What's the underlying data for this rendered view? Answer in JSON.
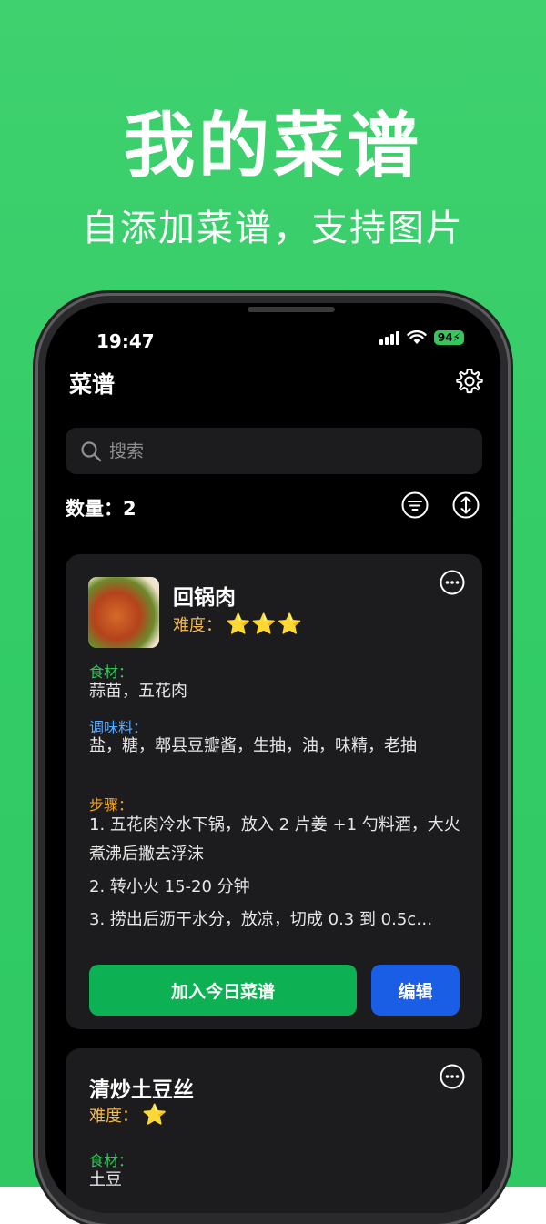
{
  "hero": {
    "title": "我的菜谱",
    "subtitle": "自添加菜谱，支持图片"
  },
  "status_bar": {
    "time": "19:47",
    "battery": "94"
  },
  "nav": {
    "title": "菜谱",
    "settings_icon": "gear-icon"
  },
  "search": {
    "placeholder": "搜索"
  },
  "list": {
    "count_label": "数量：",
    "count": "2"
  },
  "recipes": [
    {
      "name": "回锅肉",
      "difficulty_label": "难度：",
      "stars": "⭐⭐⭐",
      "difficulty": 3,
      "ingredients_label": "食材：",
      "ingredients": "蒜苗，五花肉",
      "seasoning_label": "调味料：",
      "seasoning": "盐，糖，郫县豆瓣酱，生抽，油，味精，老抽",
      "steps_label": "步骤：",
      "steps": [
        "1. 五花肉冷水下锅，放入 2 片姜 +1 勺料酒，大火煮沸后撇去浮沫",
        "2. 转小火 15-20 分钟",
        "3. 捞出后沥干水分，放凉，切成 0.3 到 0.5c…"
      ],
      "add_today_label": "加入今日菜谱",
      "edit_label": "编辑"
    },
    {
      "name": "清炒土豆丝",
      "difficulty_label": "难度：",
      "stars": "⭐",
      "difficulty": 1,
      "ingredients_label": "食材：",
      "ingredients": "土豆"
    }
  ],
  "colors": {
    "background_green": "#33cc66",
    "card": "#1c1c1e",
    "ingredients_label": "#34c759",
    "seasoning_label": "#5aa9ff",
    "steps_label": "#f5a623",
    "difficulty_label": "#f5b84a",
    "add_button": "#0db153",
    "edit_button": "#1a5ee6"
  }
}
